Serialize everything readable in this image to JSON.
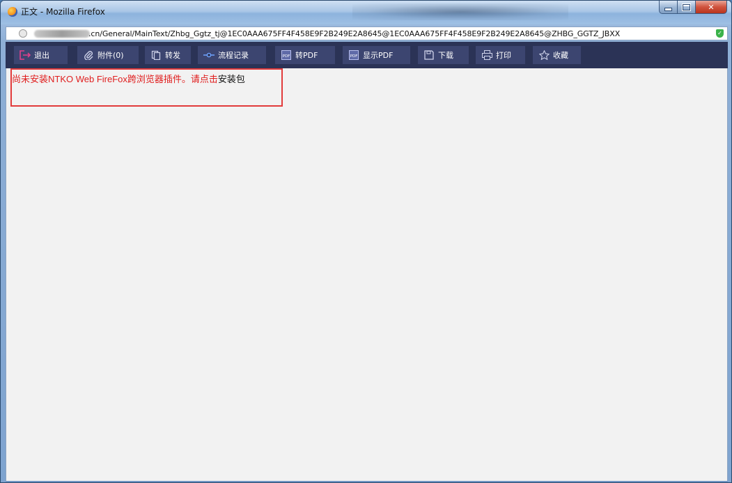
{
  "window": {
    "title": "正文 - Mozilla Firefox"
  },
  "address": {
    "url": ".cn/General/MainText/Zhbg_Ggtz_tj@1EC0AAA675FF4F458E9F2B249E2A8645@1EC0AAA675FF4F458E9F2B249E2A8645@ZHBG_GGTZ_JBXX"
  },
  "toolbar": {
    "items": [
      {
        "label": "退出",
        "icon": "exit-icon"
      },
      {
        "label": "附件(0)",
        "icon": "paperclip-icon"
      },
      {
        "label": "转发",
        "icon": "document-copy-icon"
      },
      {
        "label": "流程记录",
        "icon": "flow-icon"
      },
      {
        "label": "转PDF",
        "icon": "pdf-icon"
      },
      {
        "label": "显示PDF",
        "icon": "pdf-icon"
      },
      {
        "label": "下载",
        "icon": "save-icon"
      },
      {
        "label": "打印",
        "icon": "printer-icon"
      },
      {
        "label": "收藏",
        "icon": "star-icon"
      }
    ]
  },
  "content": {
    "notice_text": "尚未安装NTKO Web FireFox跨浏览器插件。请点击",
    "notice_link": "安装包"
  },
  "colors": {
    "toolbar_bg": "#2b3356",
    "button_bg": "#3c4570",
    "notice_red": "#e01e1e",
    "highlight_border": "#e23b3b"
  }
}
